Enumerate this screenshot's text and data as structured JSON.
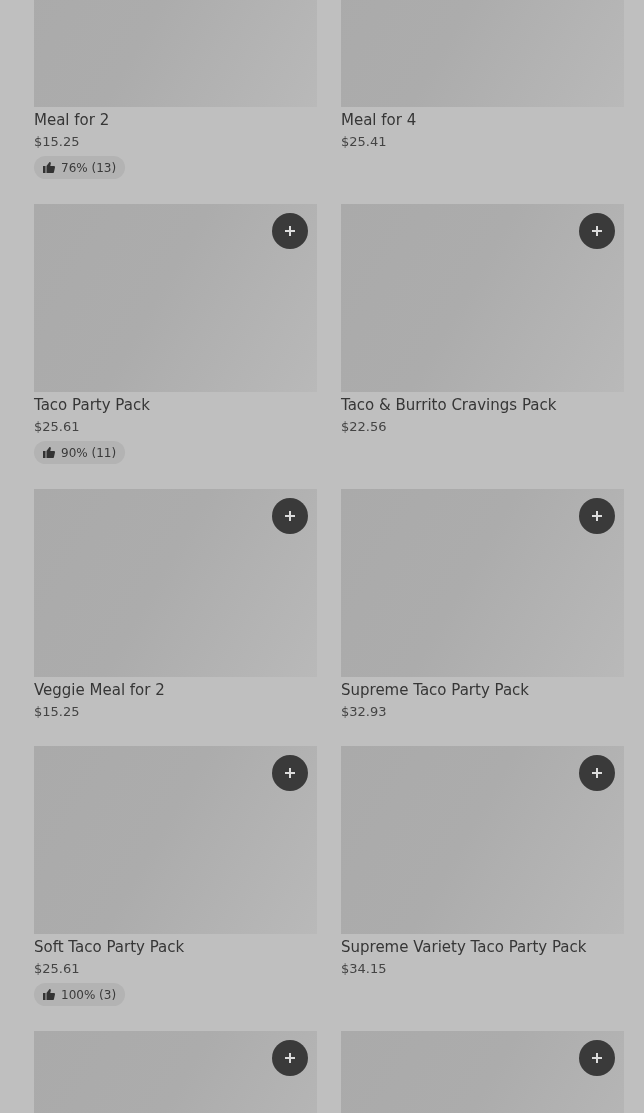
{
  "items": [
    {
      "name": "Meal for 2",
      "price": "$15.25",
      "rating": "76% (13)"
    },
    {
      "name": "Meal for 4",
      "price": "$25.41"
    },
    {
      "name": "Taco Party Pack",
      "price": "$25.61",
      "rating": "90% (11)",
      "add_button": true
    },
    {
      "name": "Taco & Burrito Cravings Pack",
      "price": "$22.56",
      "add_button": true
    },
    {
      "name": "Veggie Meal for 2",
      "price": "$15.25",
      "add_button": true
    },
    {
      "name": "Supreme Taco Party Pack",
      "price": "$32.93",
      "add_button": true
    },
    {
      "name": "Soft Taco Party Pack",
      "price": "$25.61",
      "rating": "100% (3)",
      "add_button": true
    },
    {
      "name": "Supreme Variety Taco Party Pack",
      "price": "$34.15",
      "add_button": true
    },
    {
      "add_button": true
    },
    {
      "add_button": true
    }
  ]
}
